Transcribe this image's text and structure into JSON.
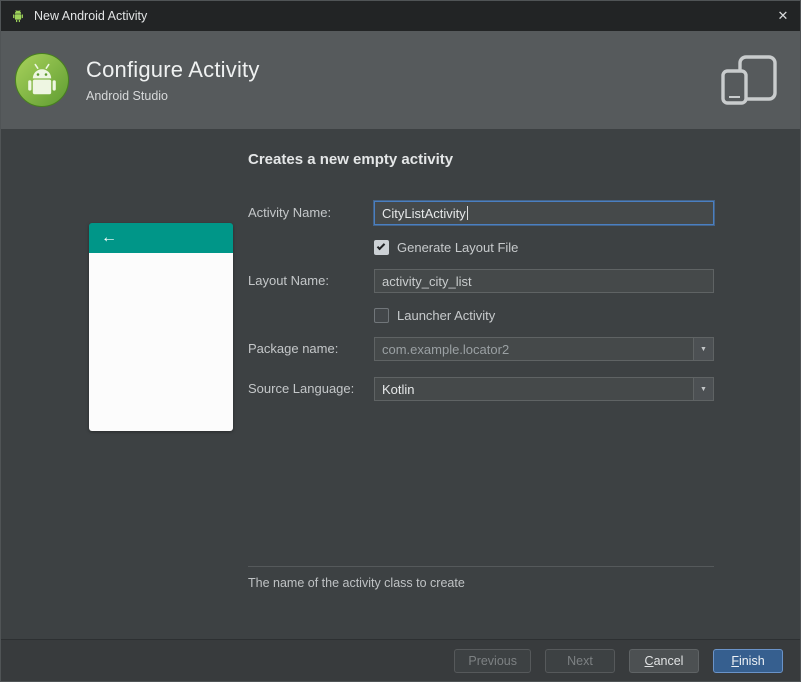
{
  "window": {
    "title": "New Android Activity"
  },
  "icons": {
    "close": "✕",
    "back_arrow": "←",
    "combo_arrow": "▼"
  },
  "header": {
    "title": "Configure Activity",
    "subtitle": "Android Studio"
  },
  "main": {
    "heading": "Creates a new empty activity",
    "form": {
      "activity_name": {
        "label": "Activity Name:",
        "value": "CityListActivity"
      },
      "generate_layout_file": {
        "label": "Generate Layout File",
        "checked": true
      },
      "layout_name": {
        "label": "Layout Name:",
        "value": "activity_city_list"
      },
      "launcher_activity": {
        "label": "Launcher Activity",
        "checked": false
      },
      "package_name": {
        "label": "Package name:",
        "value": "com.example.locator2"
      },
      "source_language": {
        "label": "Source Language:",
        "value": "Kotlin"
      }
    },
    "hint": "The name of the activity class to create"
  },
  "footer": {
    "buttons": [
      {
        "label": "Previous",
        "state": "disabled"
      },
      {
        "label": "Next",
        "state": "disabled"
      },
      {
        "label": "Cancel",
        "state": "enabled"
      },
      {
        "label": "Finish",
        "state": "default-focused"
      }
    ]
  },
  "colors": {
    "teal_accent": "#009688",
    "focus_border": "#4a7fc1",
    "finish_button": "#365f8f",
    "header_band": "#565a5c",
    "panel": "#3d4143"
  }
}
